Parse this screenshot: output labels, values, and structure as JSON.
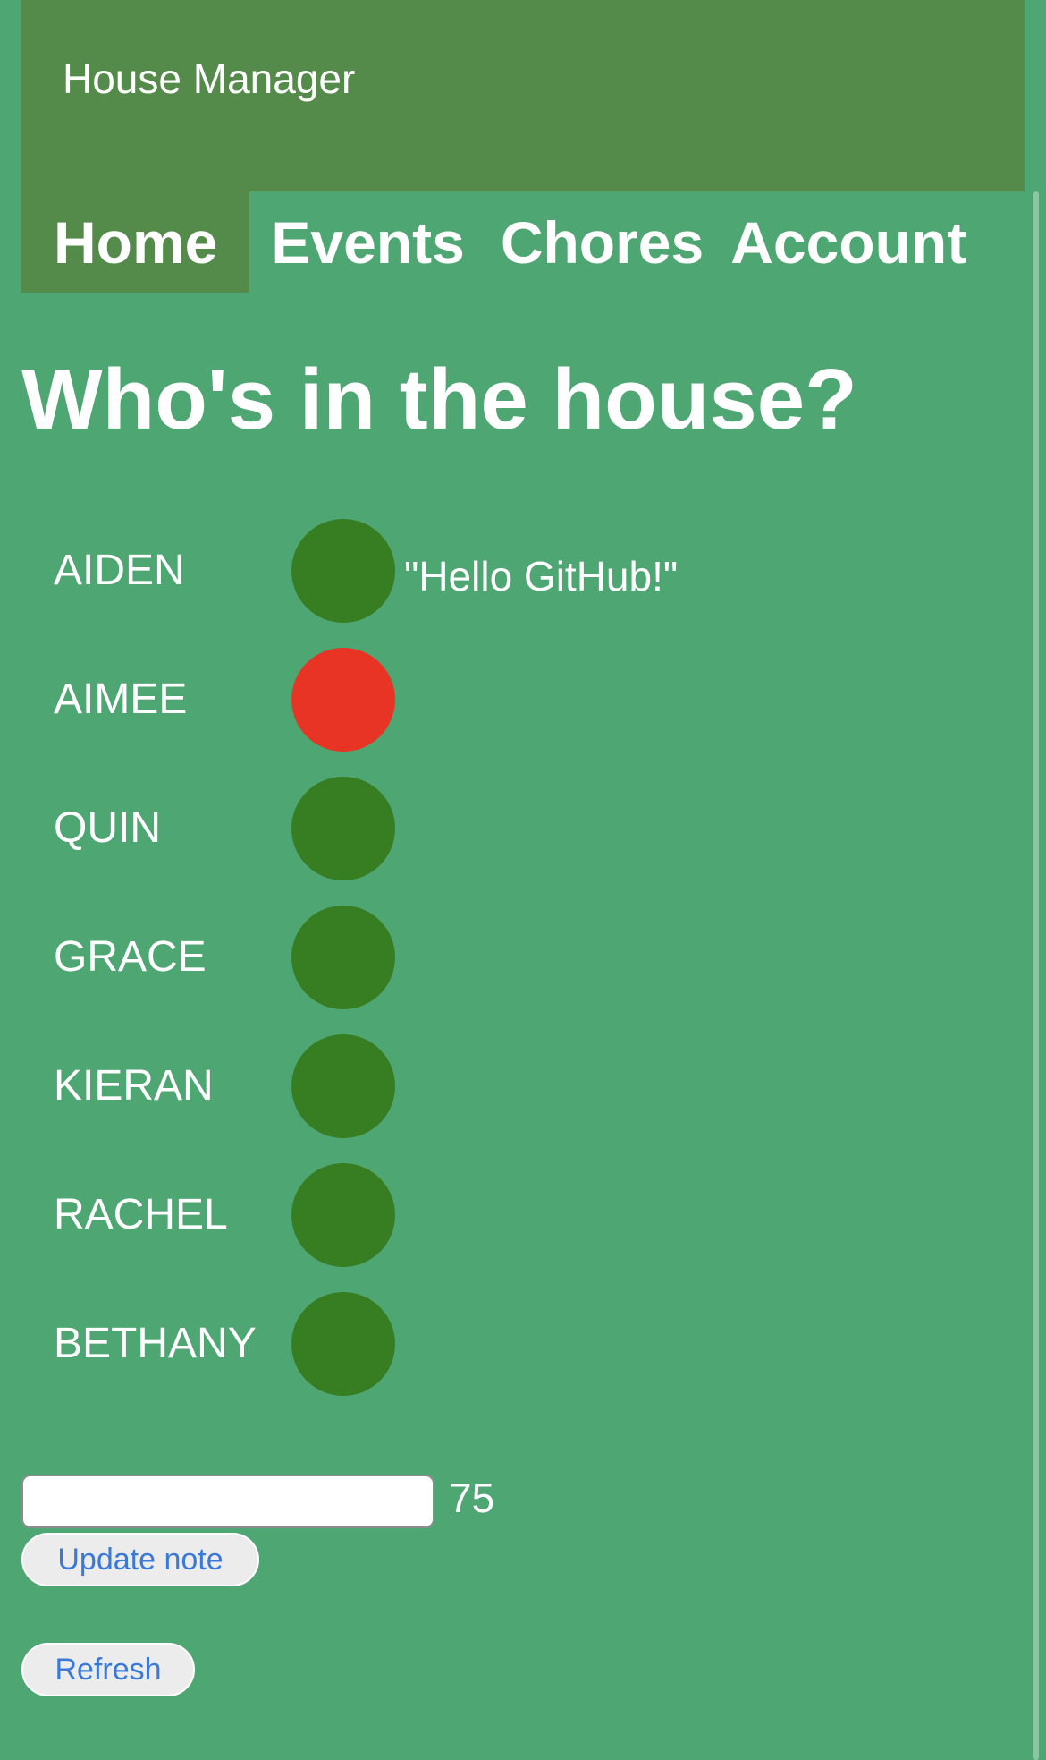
{
  "app": {
    "title": "House Manager"
  },
  "nav": {
    "items": [
      {
        "label": "Home",
        "active": true
      },
      {
        "label": "Events",
        "active": false
      },
      {
        "label": "Chores",
        "active": false
      },
      {
        "label": "Account",
        "active": false
      }
    ]
  },
  "main": {
    "heading": "Who's in the house?",
    "people": [
      {
        "name": "AIDEN",
        "status": "in",
        "status_color": "#377d22",
        "note": "\"Hello GitHub!\""
      },
      {
        "name": "AIMEE",
        "status": "out",
        "status_color": "#e83424",
        "note": ""
      },
      {
        "name": "QUIN",
        "status": "in",
        "status_color": "#377d22",
        "note": ""
      },
      {
        "name": "GRACE",
        "status": "in",
        "status_color": "#377d22",
        "note": ""
      },
      {
        "name": "KIERAN",
        "status": "in",
        "status_color": "#377d22",
        "note": ""
      },
      {
        "name": "RACHEL",
        "status": "in",
        "status_color": "#377d22",
        "note": ""
      },
      {
        "name": "BETHANY",
        "status": "in",
        "status_color": "#377d22",
        "note": ""
      }
    ]
  },
  "note_form": {
    "value": "",
    "remaining_chars": "75",
    "update_label": "Update note",
    "refresh_label": "Refresh"
  },
  "colors": {
    "background": "#4ea672",
    "header": "#558b4a",
    "status_in": "#377d22",
    "status_out": "#e83424",
    "button_text": "#3b79d8"
  }
}
